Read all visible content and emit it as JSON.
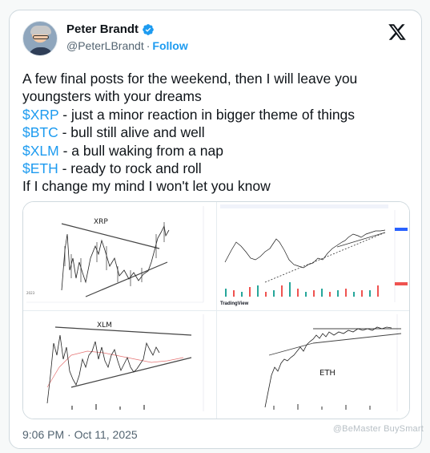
{
  "author": {
    "name": "Peter Brandt",
    "handle": "@PeterLBrandt",
    "separator": "·",
    "follow_label": "Follow"
  },
  "icons": [
    "verified-badge-icon",
    "x-logo-icon"
  ],
  "colors": {
    "accent": "#1d9bf0",
    "text": "#0f1419",
    "muted": "#536471",
    "border": "#cfd9de"
  },
  "tweet": {
    "line1": "A few final posts for the weekend, then I will leave you",
    "line2": "youngsters with your dreams",
    "line3_tag": "$XRP",
    "line3_text": " - just a minor reaction in bigger theme of things",
    "line4_tag": "$BTC",
    "line4_text": " - bull still alive and well",
    "line5_tag": "$XLM",
    "line5_text": " - a bull waking from a nap",
    "line6_tag": "$ETH",
    "line6_text": " - ready to rock and roll",
    "line7": "If I change my mind I won't let you know"
  },
  "media": {
    "charts": [
      {
        "label": "XRP"
      },
      {
        "label": ""
      },
      {
        "label": "XLM"
      },
      {
        "label": "ETH"
      }
    ],
    "tv_brand": "TradingView"
  },
  "timestamp": "9:06 PM · Oct 11, 2025",
  "watermark": "@BeMaster BuySmart"
}
